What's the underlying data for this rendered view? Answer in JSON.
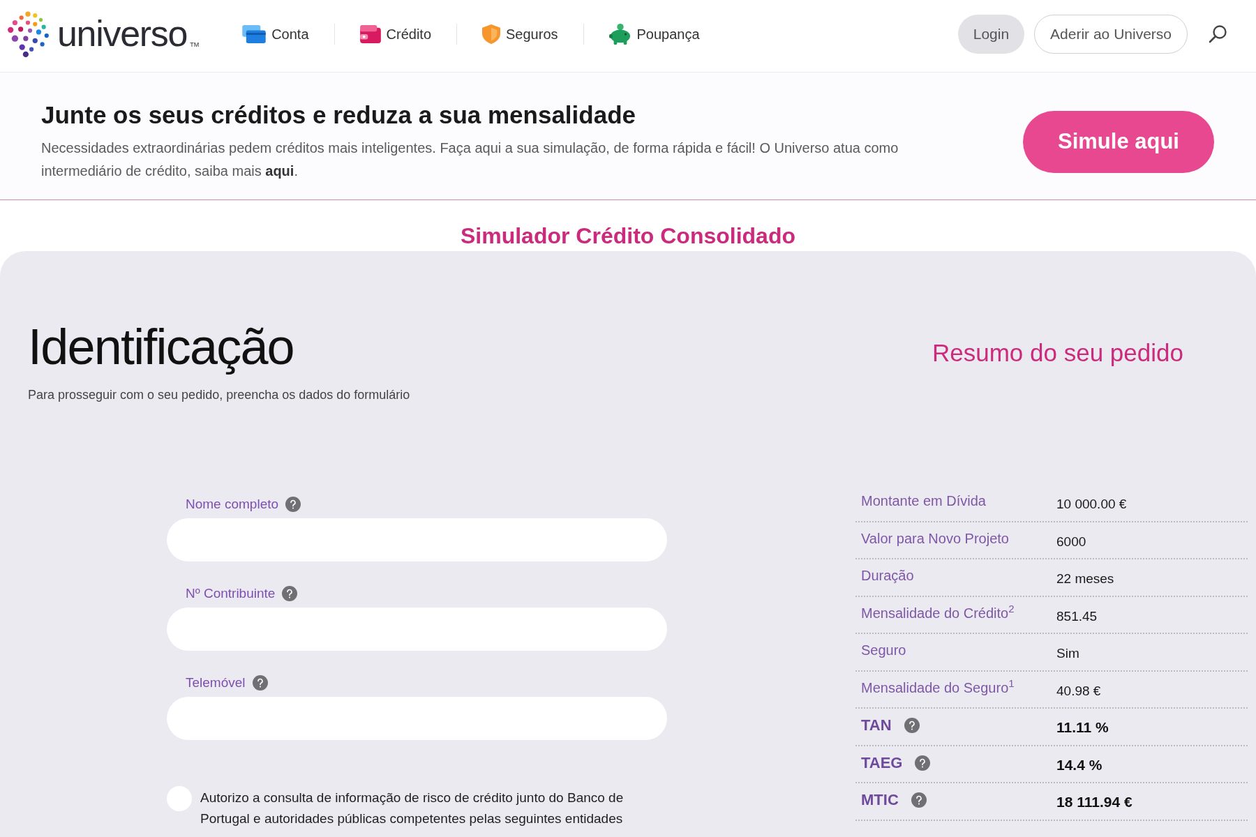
{
  "header": {
    "logo": {
      "name": "universo",
      "trademark": "TM"
    },
    "nav": [
      {
        "label": "Conta"
      },
      {
        "label": "Crédito"
      },
      {
        "label": "Seguros"
      },
      {
        "label": "Poupança"
      }
    ],
    "buttons": [
      {
        "label": "Login",
        "kind": "filled"
      },
      {
        "label": "Aderir ao Universo",
        "kind": "outline"
      }
    ]
  },
  "banner": {
    "title": "Junte os seus créditos e reduza a sua mensalidade",
    "text": "Necessidades extraordinárias pedem créditos mais inteligentes. Faça aqui a sua simulação, de forma rápida e fácil! O Universo atua como intermediário de crédito, saiba mais",
    "link": "aqui",
    "text_end": ".",
    "button": "Simule aqui"
  },
  "simulator_title": "Simulador Crédito Consolidado",
  "form": {
    "title": "Identificação",
    "subtitle": "Para prosseguir com o seu pedido, preencha os dados do formulário",
    "fields": [
      {
        "label": "Nome completo",
        "help": true
      },
      {
        "label": "Nº Contribuinte",
        "help": true
      },
      {
        "label": "Telemóvel",
        "help": true
      }
    ],
    "consent": {
      "checked": false,
      "text": "Autorizo a consulta de informação de risco de crédito junto do Banco de Portugal e autoridades públicas competentes pelas seguintes entidades"
    }
  },
  "summary": {
    "title": "Resumo do seu pedido",
    "rows": [
      {
        "label": "Montante em Dívida",
        "value": "10 000.00 €",
        "help": false,
        "bold": false
      },
      {
        "label": "Valor para Novo Projeto",
        "value": "6000",
        "help": false,
        "bold": false
      },
      {
        "label": "Duração",
        "value": "22 meses",
        "help": false,
        "bold": false
      },
      {
        "label": "Mensalidade do Crédito$^{2}$",
        "value": "851.45",
        "help": false,
        "bold": false
      },
      {
        "label": "Seguro",
        "value": "Sim",
        "help": false,
        "bold": false
      },
      {
        "label": "Mensalidade do Seguro$^{1}$",
        "value": "40.98 €",
        "help": false,
        "bold": false
      },
      {
        "label": "TAN",
        "value": "11.11 %",
        "help": true,
        "bold": true
      },
      {
        "label": "TAEG",
        "value": "14.4 %",
        "help": true,
        "bold": true
      },
      {
        "label": "MTIC",
        "value": "18 111.94 €",
        "help": true,
        "bold": true
      }
    ]
  }
}
